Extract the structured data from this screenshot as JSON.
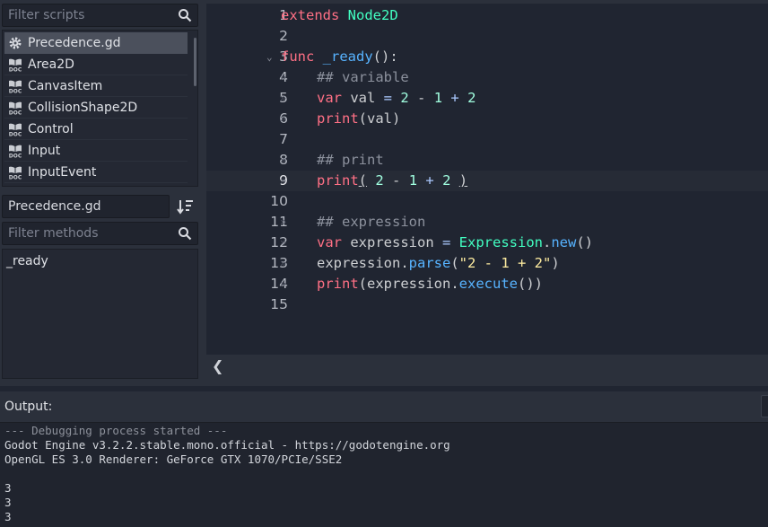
{
  "scripts_panel": {
    "filter_placeholder": "Filter scripts",
    "items": [
      {
        "label": "Precedence.gd",
        "icon": "gear-icon",
        "selected": true
      },
      {
        "label": "Area2D",
        "icon": "doc-icon"
      },
      {
        "label": "CanvasItem",
        "icon": "doc-icon"
      },
      {
        "label": "CollisionShape2D",
        "icon": "doc-icon"
      },
      {
        "label": "Control",
        "icon": "doc-icon"
      },
      {
        "label": "Input",
        "icon": "doc-icon"
      },
      {
        "label": "InputEvent",
        "icon": "doc-icon"
      }
    ]
  },
  "current_script": {
    "name": "Precedence.gd"
  },
  "methods_panel": {
    "filter_placeholder": "Filter methods",
    "items": [
      "_ready"
    ]
  },
  "editor": {
    "current_line": 9,
    "lines": [
      {
        "n": "1",
        "tokens": [
          {
            "t": "extends",
            "c": "kw"
          },
          {
            "t": " ",
            "c": "pl"
          },
          {
            "t": "Node2D",
            "c": "ty"
          }
        ]
      },
      {
        "n": "2",
        "tokens": []
      },
      {
        "n": "3",
        "fold": true,
        "tokens": [
          {
            "t": "func",
            "c": "kw"
          },
          {
            "t": " ",
            "c": "pl"
          },
          {
            "t": "_ready",
            "c": "fn"
          },
          {
            "t": "():",
            "c": "pl"
          }
        ]
      },
      {
        "n": "4",
        "indent": true,
        "tokens": [
          {
            "t": "## variable",
            "c": "cm"
          }
        ]
      },
      {
        "n": "5",
        "indent": true,
        "tokens": [
          {
            "t": "var",
            "c": "kw"
          },
          {
            "t": " val ",
            "c": "pl"
          },
          {
            "t": "=",
            "c": "sym"
          },
          {
            "t": " ",
            "c": "pl"
          },
          {
            "t": "2",
            "c": "num"
          },
          {
            "t": " - ",
            "c": "pl"
          },
          {
            "t": "1",
            "c": "num"
          },
          {
            "t": " ",
            "c": "pl"
          },
          {
            "t": "+",
            "c": "sym"
          },
          {
            "t": " ",
            "c": "pl"
          },
          {
            "t": "2",
            "c": "num"
          }
        ]
      },
      {
        "n": "6",
        "indent": true,
        "tokens": [
          {
            "t": "print",
            "c": "kw"
          },
          {
            "t": "(val)",
            "c": "pl"
          }
        ]
      },
      {
        "n": "7",
        "tokens": []
      },
      {
        "n": "8",
        "indent": true,
        "tokens": [
          {
            "t": "## print",
            "c": "cm"
          }
        ]
      },
      {
        "n": "9",
        "indent": true,
        "tokens": [
          {
            "t": "print",
            "c": "kw"
          },
          {
            "t": "(",
            "c": "pl brk"
          },
          {
            "t": " ",
            "c": "pl"
          },
          {
            "t": "2",
            "c": "num"
          },
          {
            "t": " - ",
            "c": "pl"
          },
          {
            "t": "1",
            "c": "num"
          },
          {
            "t": " ",
            "c": "pl"
          },
          {
            "t": "+",
            "c": "sym"
          },
          {
            "t": " ",
            "c": "pl"
          },
          {
            "t": "2",
            "c": "num"
          },
          {
            "t": " ",
            "c": "pl"
          },
          {
            "t": ")",
            "c": "pl brk"
          }
        ]
      },
      {
        "n": "10",
        "tokens": []
      },
      {
        "n": "11",
        "indent": true,
        "tokens": [
          {
            "t": "## expression",
            "c": "cm"
          }
        ]
      },
      {
        "n": "12",
        "indent": true,
        "tokens": [
          {
            "t": "var",
            "c": "kw"
          },
          {
            "t": " expression ",
            "c": "pl"
          },
          {
            "t": "=",
            "c": "sym"
          },
          {
            "t": " ",
            "c": "pl"
          },
          {
            "t": "Expression",
            "c": "ty"
          },
          {
            "t": ".",
            "c": "pl"
          },
          {
            "t": "new",
            "c": "fn"
          },
          {
            "t": "()",
            "c": "pl"
          }
        ]
      },
      {
        "n": "13",
        "indent": true,
        "tokens": [
          {
            "t": "expression.",
            "c": "pl"
          },
          {
            "t": "parse",
            "c": "fn"
          },
          {
            "t": "(",
            "c": "pl"
          },
          {
            "t": "\"2 - 1 + 2\"",
            "c": "str"
          },
          {
            "t": ")",
            "c": "pl"
          }
        ]
      },
      {
        "n": "14",
        "indent": true,
        "tokens": [
          {
            "t": "print",
            "c": "kw"
          },
          {
            "t": "(expression.",
            "c": "pl"
          },
          {
            "t": "execute",
            "c": "fn"
          },
          {
            "t": "())",
            "c": "pl"
          }
        ]
      },
      {
        "n": "15",
        "tokens": []
      }
    ]
  },
  "output": {
    "title": "Output:",
    "lines": [
      {
        "text": "--- Debugging process started ---",
        "muted": true
      },
      {
        "text": "Godot Engine v3.2.2.stable.mono.official - https://godotengine.org"
      },
      {
        "text": "OpenGL ES 3.0 Renderer: GeForce GTX 1070/PCIe/SSE2"
      },
      {
        "text": ""
      },
      {
        "text": "3"
      },
      {
        "text": "3"
      },
      {
        "text": "3"
      }
    ]
  },
  "colors": {
    "keyword": "#ff7085",
    "type": "#42ffc2",
    "function": "#57b3ff",
    "number": "#a1ffe0",
    "string": "#ffeda1",
    "comment": "#8c919d"
  }
}
